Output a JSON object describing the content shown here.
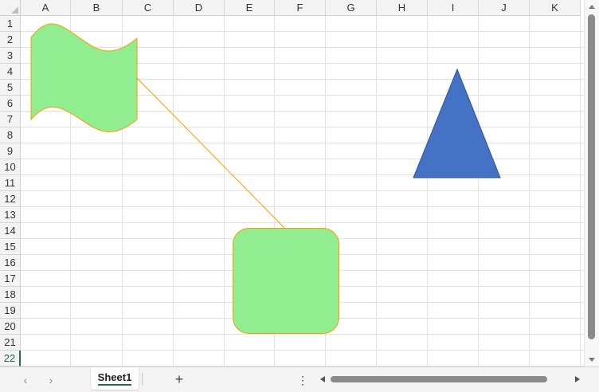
{
  "grid": {
    "columns": [
      "A",
      "B",
      "C",
      "D",
      "E",
      "F",
      "G",
      "H",
      "I",
      "J",
      "K"
    ],
    "rows": [
      "1",
      "2",
      "3",
      "4",
      "5",
      "6",
      "7",
      "8",
      "9",
      "10",
      "11",
      "12",
      "13",
      "14",
      "15",
      "16",
      "17",
      "18",
      "19",
      "20",
      "21",
      "22"
    ],
    "active_row": "22"
  },
  "shapes": [
    {
      "kind": "wave-flag",
      "fill": "#90ee90",
      "stroke": "#ff9900"
    },
    {
      "kind": "connector-line",
      "stroke": "#ff9900"
    },
    {
      "kind": "rounded-rectangle",
      "fill": "#90ee90",
      "stroke": "#ff9900"
    },
    {
      "kind": "triangle",
      "fill": "#4472c4",
      "stroke": "#2f528f"
    }
  ],
  "sheetbar": {
    "prev_icon": "chevron-left-icon",
    "next_icon": "chevron-right-icon",
    "tabs": [
      {
        "label": "Sheet1",
        "active": true
      }
    ],
    "add_sheet_label": "+",
    "more_label": "⋮"
  },
  "colors": {
    "header_bg": "#f3f3f3",
    "gridline": "#e1e1e1",
    "accent": "#217346"
  }
}
